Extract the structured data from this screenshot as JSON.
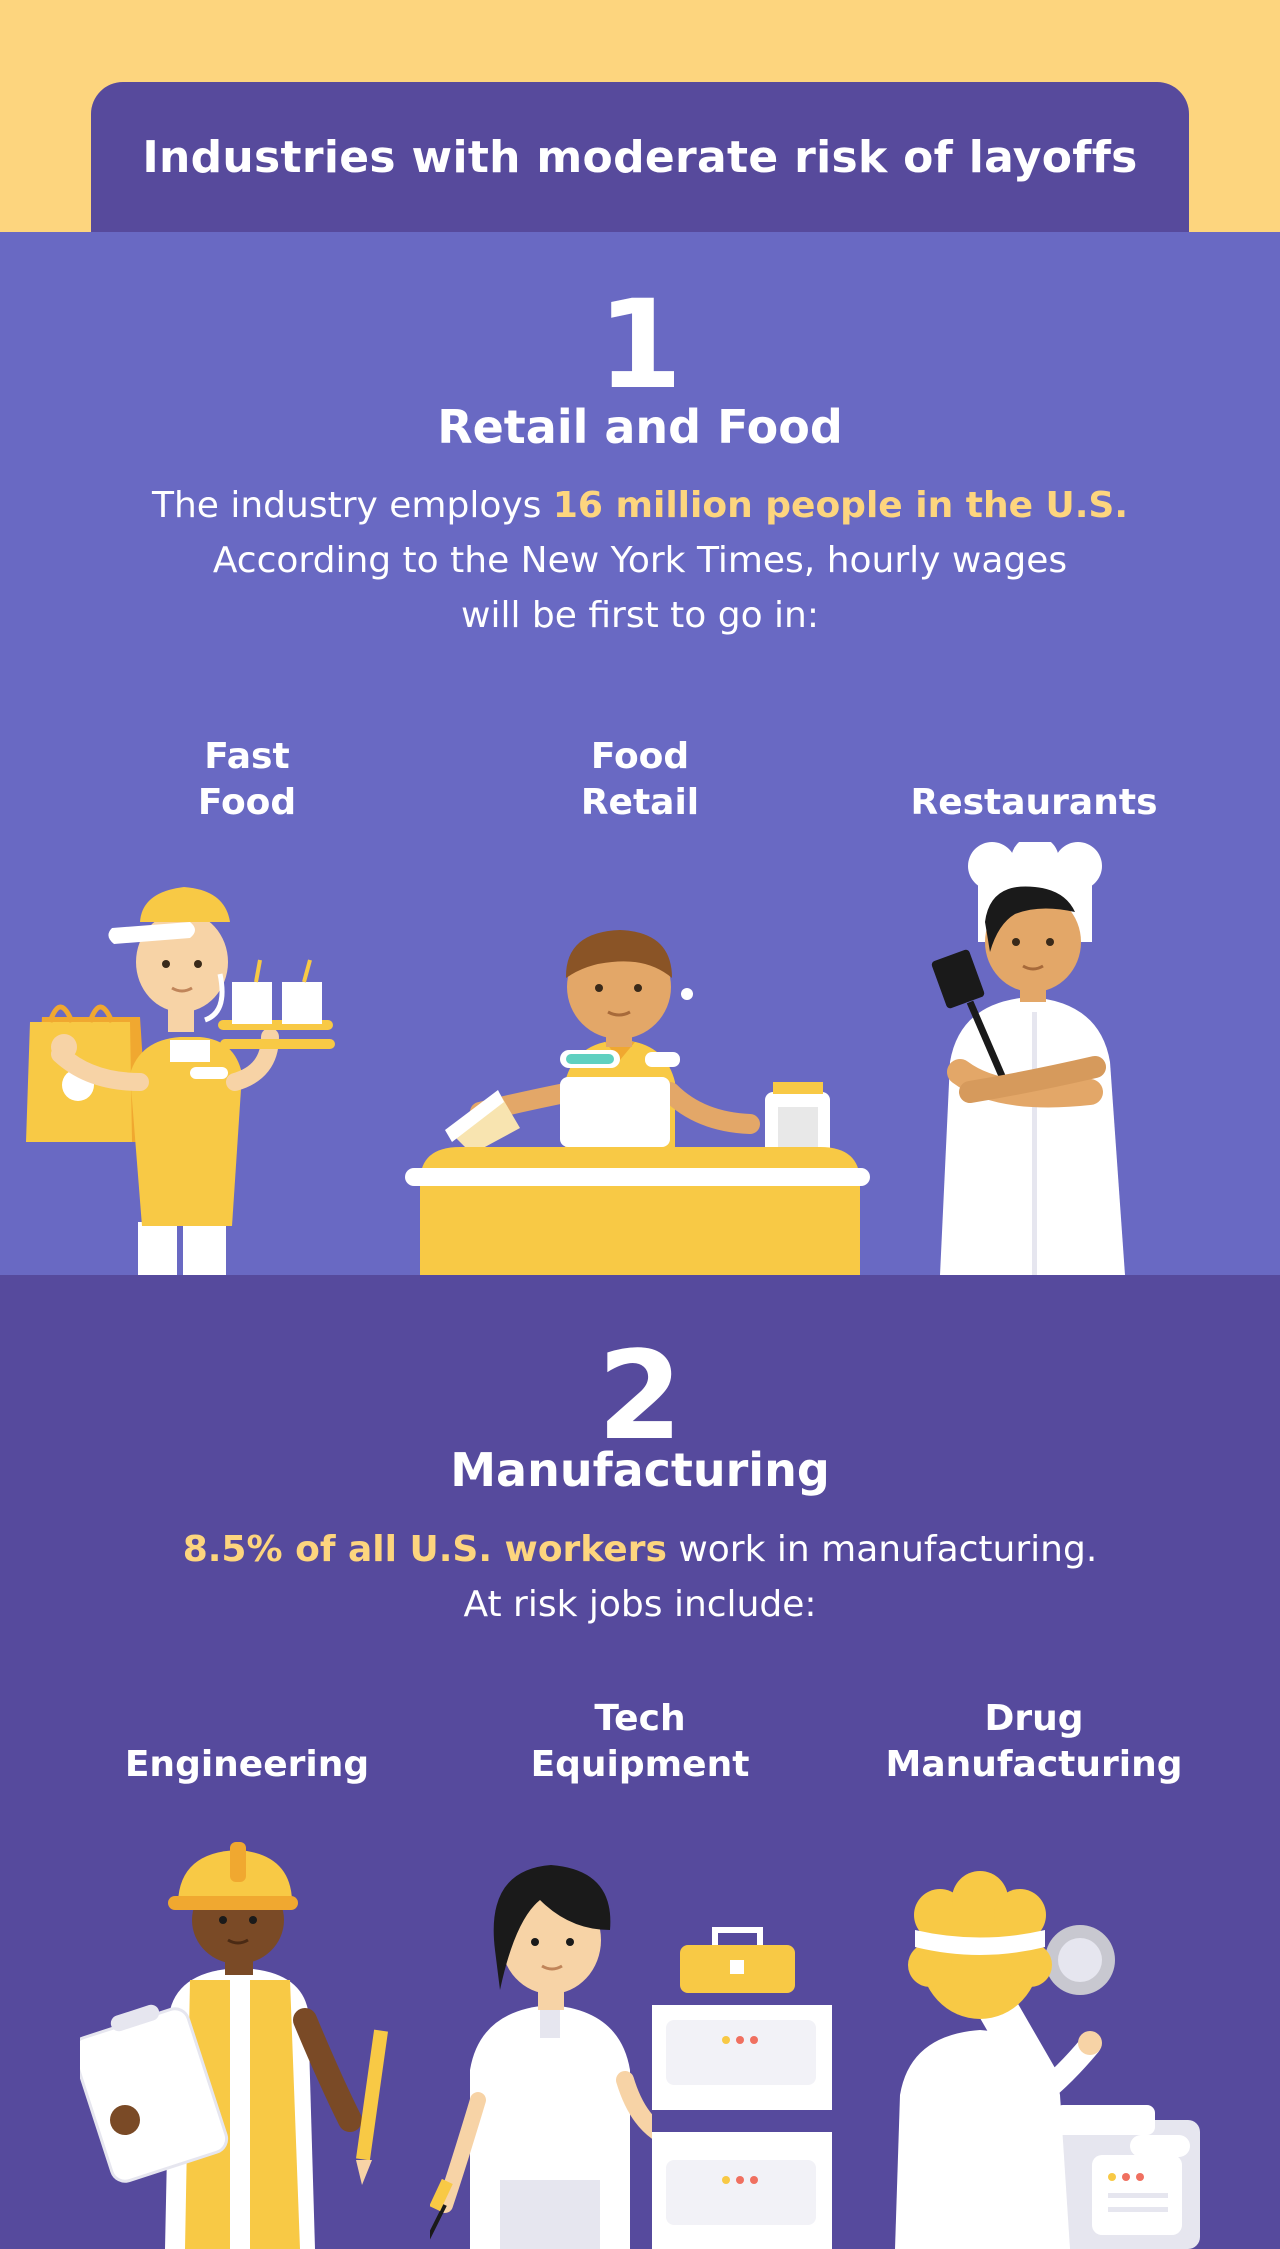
{
  "title": "Industries with moderate risk of layoffs",
  "section1": {
    "number": "1",
    "heading": "Retail and Food",
    "text_before": "The industry employs ",
    "highlight": "16 million people in the U.S.",
    "text_after": "According to the New York Times, hourly wages will be first to go in:",
    "categories": [
      {
        "line1": "Fast",
        "line2": "Food"
      },
      {
        "line1": "Food",
        "line2": "Retail"
      },
      {
        "line1": "",
        "line2": "Restaurants"
      }
    ]
  },
  "section2": {
    "number": "2",
    "heading": "Manufacturing",
    "highlight": "8.5% of all U.S. workers",
    "text_after": " work in manufacturing.",
    "text_line2": "At risk jobs include:",
    "categories": [
      {
        "line1": "",
        "line2": "Engineering"
      },
      {
        "line1": "Tech",
        "line2": "Equipment"
      },
      {
        "line1": "Drug",
        "line2": "Manufacturing"
      }
    ]
  },
  "colors": {
    "yellow": "#fdd57e",
    "section1_bg": "#6969c3",
    "section2_bg": "#564a9d",
    "accent_yellow": "#f8c945",
    "skin_light": "#f7d3a6",
    "skin_mid": "#e3a768",
    "skin_dark": "#7a4a26"
  }
}
